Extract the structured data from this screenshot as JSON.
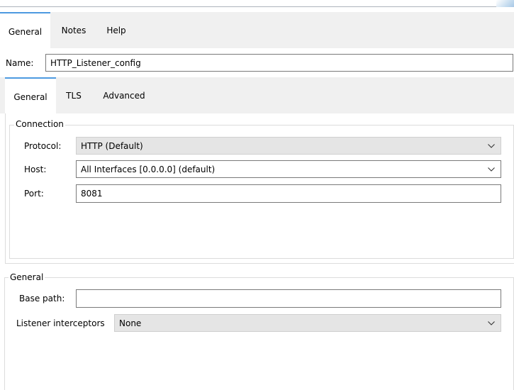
{
  "tabs_top": [
    {
      "label": "General",
      "active": true
    },
    {
      "label": "Notes",
      "active": false
    },
    {
      "label": "Help",
      "active": false
    }
  ],
  "name": {
    "label": "Name:",
    "value": "HTTP_Listener_config"
  },
  "tabs_inner": [
    {
      "label": "General",
      "active": true
    },
    {
      "label": "TLS",
      "active": false
    },
    {
      "label": "Advanced",
      "active": false
    }
  ],
  "connection": {
    "title": "Connection",
    "protocol_label": "Protocol:",
    "protocol_value": "HTTP (Default)",
    "host_label": "Host:",
    "host_value": "All Interfaces [0.0.0.0] (default)",
    "port_label": "Port:",
    "port_value": "8081"
  },
  "general": {
    "title": "General",
    "base_path_label": "Base path:",
    "base_path_value": "",
    "interceptors_label": "Listener interceptors",
    "interceptors_value": "None"
  },
  "icons": {
    "dropdown": "chevron-down-icon"
  },
  "colors": {
    "active_tab_accent": "#4d9ae0",
    "tab_strip_bg": "#f0f0f0",
    "combo_bg": "#e5e5e5"
  }
}
